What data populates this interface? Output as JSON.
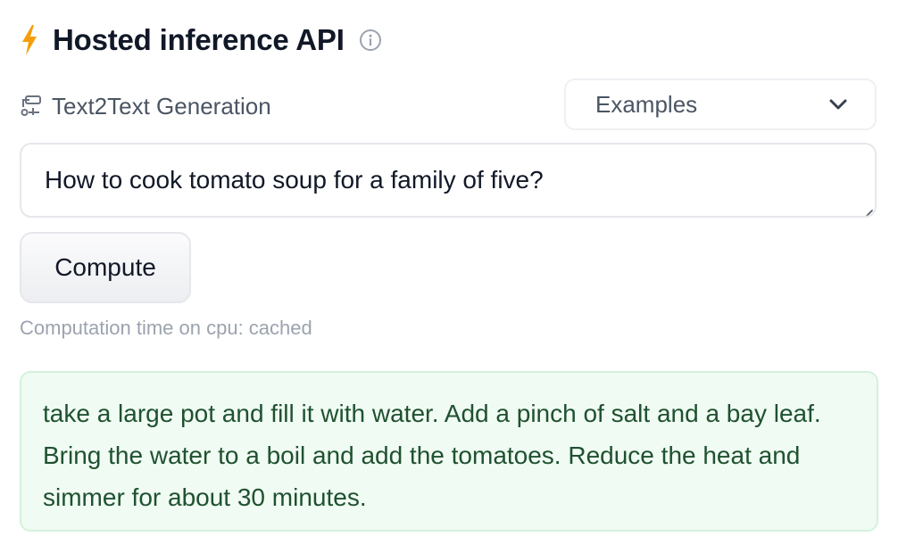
{
  "header": {
    "title": "Hosted inference API",
    "icons": {
      "lightning": "lightning-bolt-icon",
      "info": "info-circle-icon"
    },
    "accent_color": "#f59e0b"
  },
  "task": {
    "icon": "pipeline-icon",
    "label": "Text2Text Generation"
  },
  "examples": {
    "label": "Examples",
    "icon": "chevron-down-icon"
  },
  "input": {
    "value": "How to cook tomato soup for a family of five?"
  },
  "compute": {
    "label": "Compute"
  },
  "status": {
    "computation_time": "Computation time on cpu: cached"
  },
  "output": {
    "text": "take a large pot and fill it with water. Add a pinch of salt and a bay leaf. Bring the water to a boil and add the tomatoes. Reduce the heat and simmer for about 30 minutes.",
    "background_color": "#f0fbf3",
    "text_color": "#1f5130"
  }
}
